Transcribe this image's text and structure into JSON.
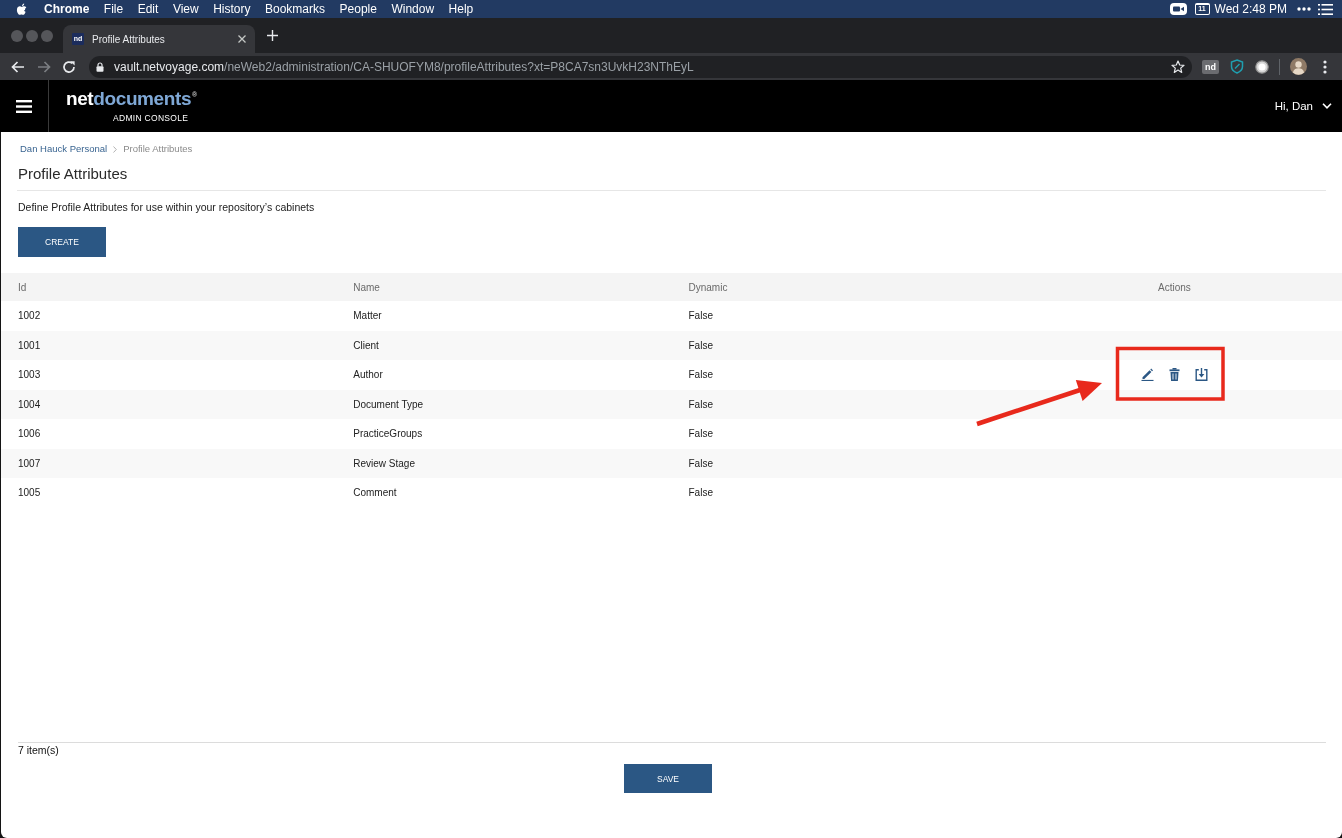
{
  "menu_bar": {
    "app_name": "Chrome",
    "menus": [
      "File",
      "Edit",
      "View",
      "History",
      "Bookmarks",
      "People",
      "Window",
      "Help"
    ],
    "calendar_day": "11",
    "clock": "Wed 2:48 PM"
  },
  "browser": {
    "tabs": [
      {
        "favicon": "nd",
        "title": "Profile Attributes",
        "selected": true
      }
    ],
    "url": {
      "host": "vault.netvoyage.com",
      "path": "/neWeb2/administration/CA-SHUOFYM8/profileAttributes?xt=P8CA7sn3UvkH23NThEyL"
    },
    "extension_label": "nd"
  },
  "app_header": {
    "logo": {
      "part_1": "net",
      "part_2": "documents",
      "mark": "®",
      "subtitle": "ADMIN CONSOLE"
    },
    "user_menu": "Hi, Dan"
  },
  "breadcrumb": [
    {
      "label": "Dan Hauck Personal",
      "link": true
    },
    {
      "label": "Profile Attributes",
      "link": false
    }
  ],
  "page_title": "Profile Attributes",
  "description": "Define Profile Attributes for use within your repository’s cabinets",
  "create_button": "CREATE",
  "table": {
    "columns": [
      "Id",
      "Name",
      "Dynamic",
      "Actions"
    ],
    "rows": [
      {
        "id": "1002",
        "name": "Matter",
        "dynamic": "False",
        "hovered": false
      },
      {
        "id": "1001",
        "name": "Client",
        "dynamic": "False",
        "hovered": false
      },
      {
        "id": "1003",
        "name": "Author",
        "dynamic": "False",
        "hovered": true
      },
      {
        "id": "1004",
        "name": "Document Type",
        "dynamic": "False",
        "hovered": false
      },
      {
        "id": "1006",
        "name": "PracticeGroups",
        "dynamic": "False",
        "hovered": false
      },
      {
        "id": "1007",
        "name": "Review Stage",
        "dynamic": "False",
        "hovered": false
      },
      {
        "id": "1005",
        "name": "Comment",
        "dynamic": "False",
        "hovered": false
      }
    ]
  },
  "item_count": "7 item(s)",
  "save_button": "SAVE"
}
